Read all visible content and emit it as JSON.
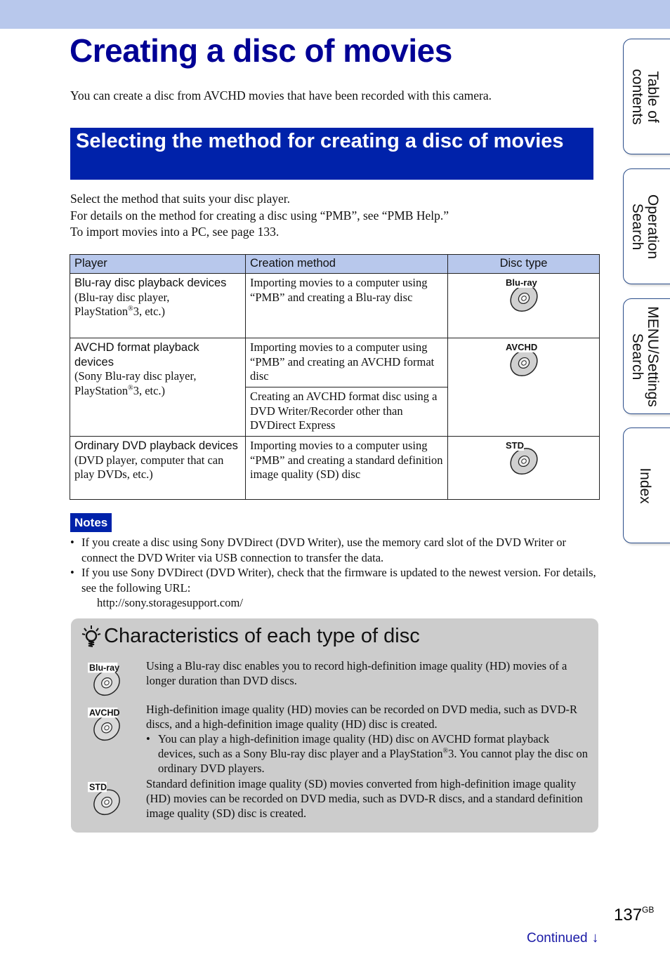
{
  "header": {
    "title": "Creating a disc of movies",
    "intro": "You can create a disc from AVCHD movies that have been recorded with this camera."
  },
  "section": {
    "heading": "Selecting the method for creating a disc of movies",
    "lines": [
      "Select the method that suits your disc player.",
      "For details on the method for creating a disc using “PMB”, see “PMB Help.”",
      "To import movies into a PC, see page 133."
    ]
  },
  "table": {
    "headers": [
      "Player",
      "Creation method",
      "Disc type"
    ],
    "rows": [
      {
        "player_name": "Blu-ray disc playback devices",
        "player_detail_a": "(Blu-ray disc player,",
        "player_detail_b": "PlayStation",
        "player_detail_c": "3, etc.)",
        "methods": [
          "Importing movies to a computer using “PMB” and creating a Blu-ray disc"
        ],
        "disc": "Blu-ray"
      },
      {
        "player_name": "AVCHD format playback devices",
        "player_detail_a": "(Sony Blu-ray disc player,",
        "player_detail_b": "PlayStation",
        "player_detail_c": "3, etc.)",
        "methods": [
          "Importing movies to a computer using “PMB” and creating an AVCHD format disc",
          "Creating an AVCHD format disc using a DVD Writer/Recorder other than DVDirect Express"
        ],
        "disc": "AVCHD"
      },
      {
        "player_name": "Ordinary DVD playback devices",
        "player_detail_a": "(DVD player, computer that can play DVDs, etc.)",
        "methods": [
          "Importing movies to a computer using “PMB” and creating a standard definition image quality (SD) disc"
        ],
        "disc": "STD"
      }
    ],
    "registered": "®"
  },
  "notes": {
    "label": "Notes",
    "items": [
      "If you create a disc using Sony DVDirect (DVD Writer), use the memory card slot of the DVD Writer or connect the DVD Writer via USB connection to transfer the data.",
      "If you use Sony DVDirect (DVD Writer), check that the firmware is updated to the newest version. For details, see the following URL:"
    ],
    "url": "http://sony.storagesupport.com/"
  },
  "hint": {
    "title": "Characteristics of each type of disc",
    "bluray": "Using a Blu-ray disc enables you to record high-definition image quality (HD) movies of a longer duration than DVD discs.",
    "avchd": "High-definition image quality (HD) movies can be recorded on DVD media, such as DVD-R discs, and a high-definition image quality (HD) disc is created.",
    "avchd_sub_a": "You can play a high-definition image quality (HD) disc on AVCHD format playback devices, such as a Sony Blu-ray disc player and a PlayStation",
    "avchd_sub_b": "3. You cannot play the disc on ordinary DVD players.",
    "std": "Standard definition image quality (SD) movies converted from high-definition image quality (HD) movies can be recorded on DVD media, such as DVD-R discs, and a standard definition image quality (SD) disc is created."
  },
  "side_tabs": [
    {
      "line1": "Table of",
      "line2": "contents"
    },
    {
      "line1": "Operation",
      "line2": "Search"
    },
    {
      "line1": "MENU/Settings",
      "line2": "Search"
    },
    {
      "line1": "Index",
      "line2": ""
    }
  ],
  "footer": {
    "page": "137",
    "suffix": "GB",
    "continued": "Continued",
    "arrow_icon": "↓"
  },
  "colors": {
    "title": "#000095",
    "heading_bg": "#0022aa",
    "header_band": "#b8c8ec",
    "hint_bg": "#cccccc"
  }
}
